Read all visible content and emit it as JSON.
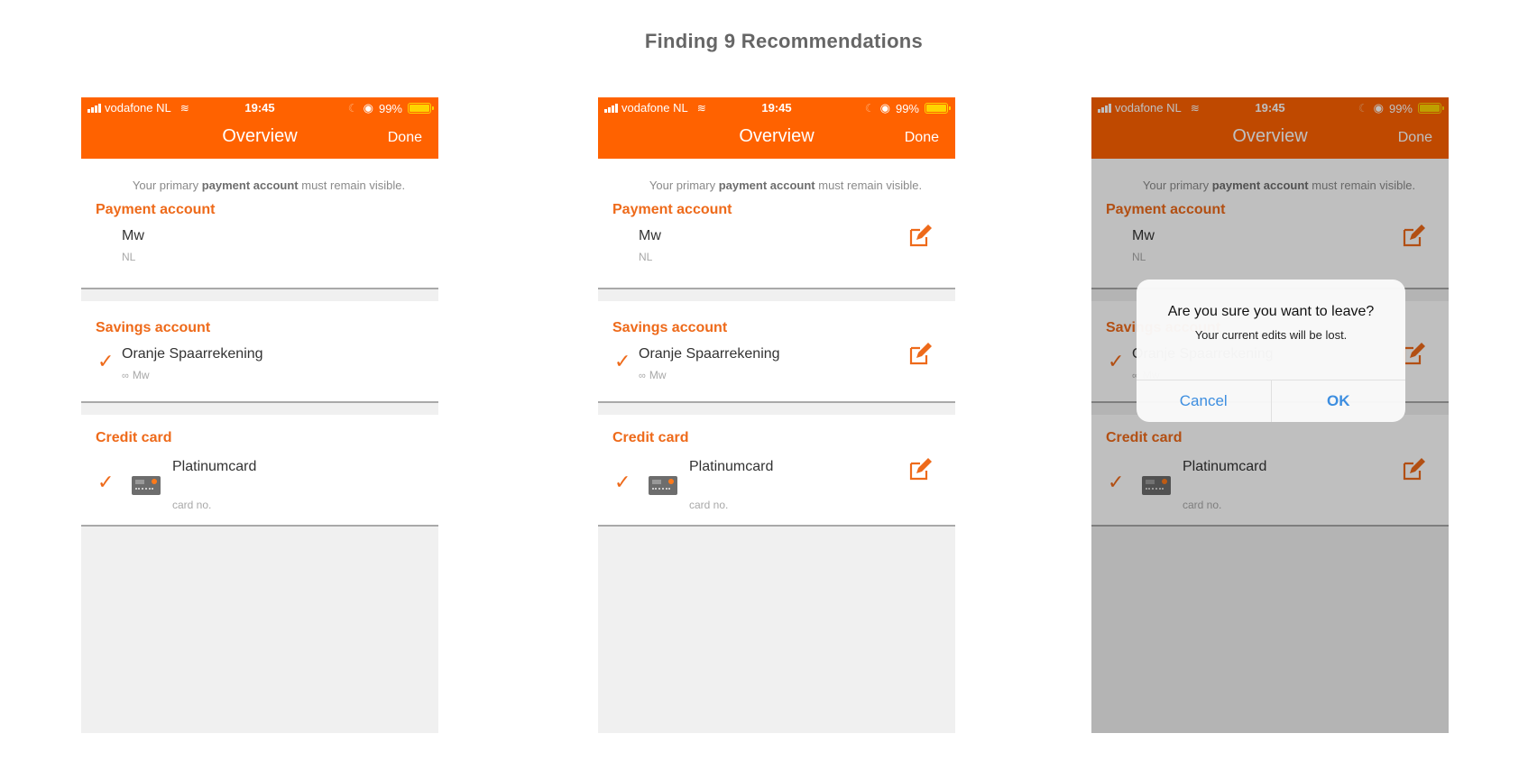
{
  "page_title": "Finding 9 Recommendations",
  "colors": {
    "brand_orange": "#ff6200",
    "section_orange": "#ee6a1a",
    "ios_blue": "#3d8ee0",
    "overlay": "rgba(0,0,0,0.25)"
  },
  "status_bar": {
    "carrier": "vodafone NL",
    "time": "19:45",
    "battery": "99%",
    "battery_fraction": 0.99
  },
  "nav": {
    "title": "Overview",
    "done": "Done"
  },
  "hint": {
    "prefix": "Your primary ",
    "bold": "payment account",
    "suffix": " must remain visible."
  },
  "sections": {
    "payment": {
      "title": "Payment account",
      "name": "Mw",
      "sub": "NL"
    },
    "savings": {
      "title": "Savings account",
      "name": "Oranje Spaarrekening",
      "sub": "Mw"
    },
    "credit": {
      "title": "Credit card",
      "name": "Platinumcard",
      "sub": "card no."
    }
  },
  "icons": {
    "check": "✓",
    "link": "∞",
    "wifi": "≋",
    "moon": "☾",
    "rotation_lock": "◉"
  },
  "dialog": {
    "title": "Are you sure you want to leave?",
    "message": "Your current edits will be lost.",
    "cancel": "Cancel",
    "ok": "OK"
  }
}
